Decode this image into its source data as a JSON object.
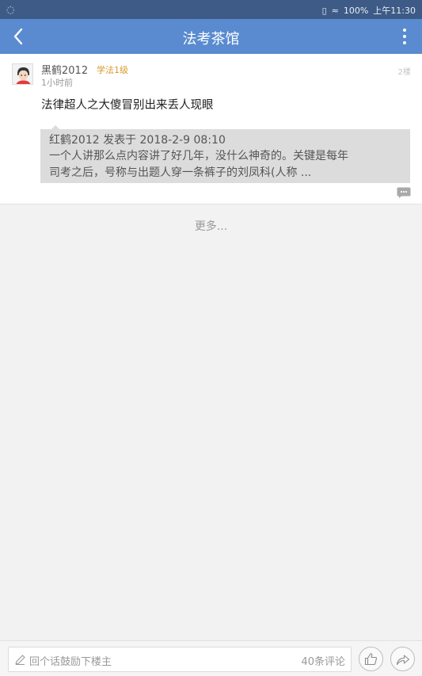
{
  "status_bar": {
    "battery": "100%",
    "time": "上午11:30"
  },
  "header": {
    "title": "法考茶馆",
    "back_icon": "back-arrow-icon",
    "more_icon": "more-vertical-icon",
    "colors": {
      "bar": "#5a8bd0",
      "status": "#3d5b86"
    }
  },
  "post": {
    "username": "黑鹤2012",
    "level": "学法1级",
    "time_ago": "1小时前",
    "floor": "2楼",
    "content": "法律超人之大傻冒别出来丢人现眼",
    "quote": {
      "header": "红鹤2012 发表于 2018-2-9 08:10",
      "line1": "一个人讲那么点内容讲了好几年，没什么神奇的。关键是每年",
      "line2": "司考之后，号称与出题人穿一条裤子的刘凤科(人称 ..."
    },
    "level_color": "#d89a2a"
  },
  "more_label": "更多...",
  "bottom_bar": {
    "reply_placeholder": "回个话鼓励下楼主",
    "comment_count": "40条评论",
    "like_icon": "thumbs-up-icon",
    "share_icon": "share-icon"
  }
}
